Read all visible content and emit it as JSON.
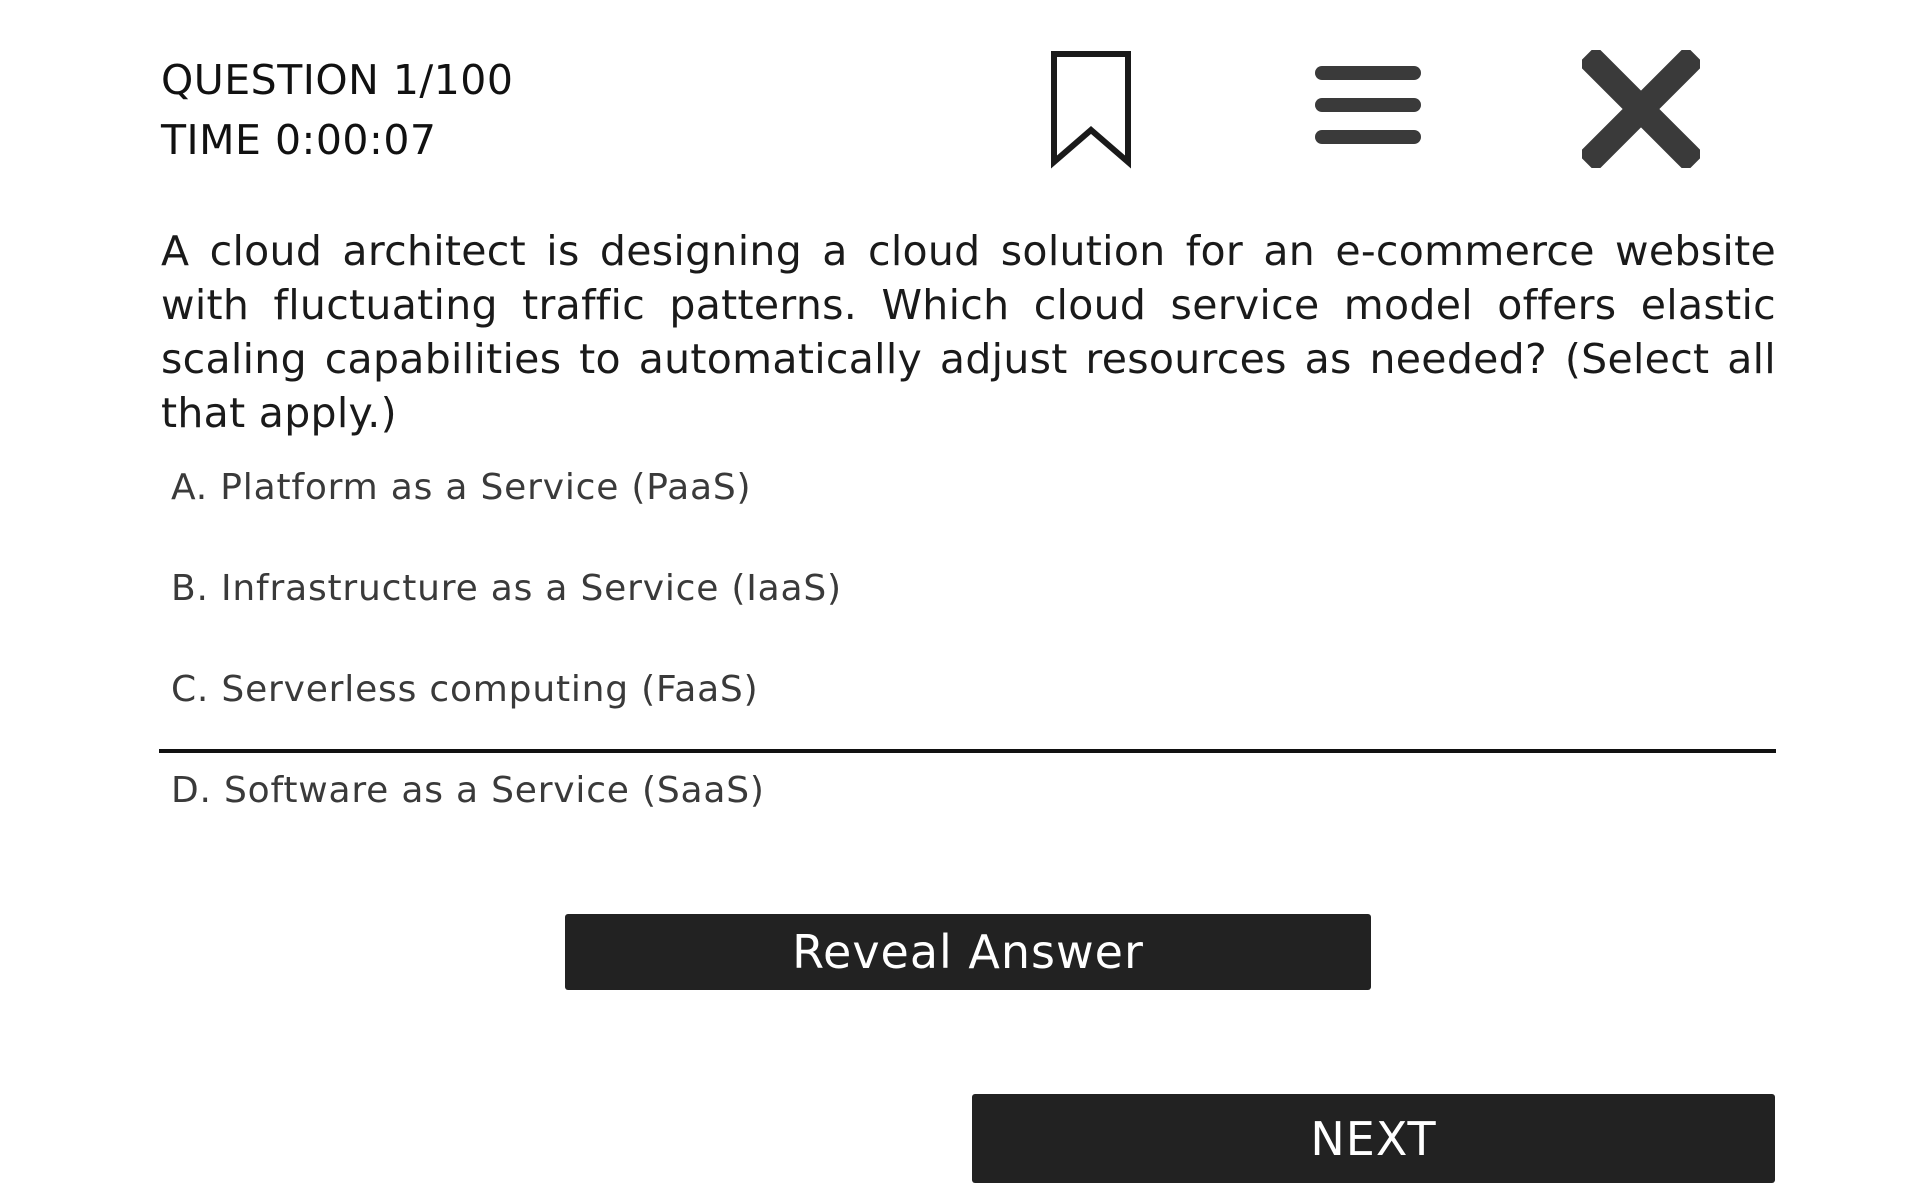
{
  "header": {
    "question_counter": "QUESTION 1/100",
    "timer": "TIME 0:00:07",
    "icons": {
      "bookmark": "bookmark-icon",
      "menu": "hamburger-menu-icon",
      "close": "close-icon"
    }
  },
  "question": {
    "text": "A cloud architect is designing a cloud solution for an e-commerce website with fluctuating traffic patterns. Which cloud service model offers elastic scaling capabilities to automatically adjust resources as needed? (Select all that apply.)"
  },
  "options": [
    {
      "label": "A. Platform as a Service (PaaS)"
    },
    {
      "label": "B. Infrastructure as a Service (IaaS)"
    },
    {
      "label": "C. Serverless computing (FaaS)"
    },
    {
      "label": "D. Software as a Service (SaaS)"
    }
  ],
  "actions": {
    "reveal_label": "Reveal Answer",
    "next_label": "NEXT"
  },
  "colors": {
    "button_bg": "#222222",
    "button_text": "#ffffff",
    "icon": "#3a3a3a",
    "text": "#1a1a1a"
  }
}
